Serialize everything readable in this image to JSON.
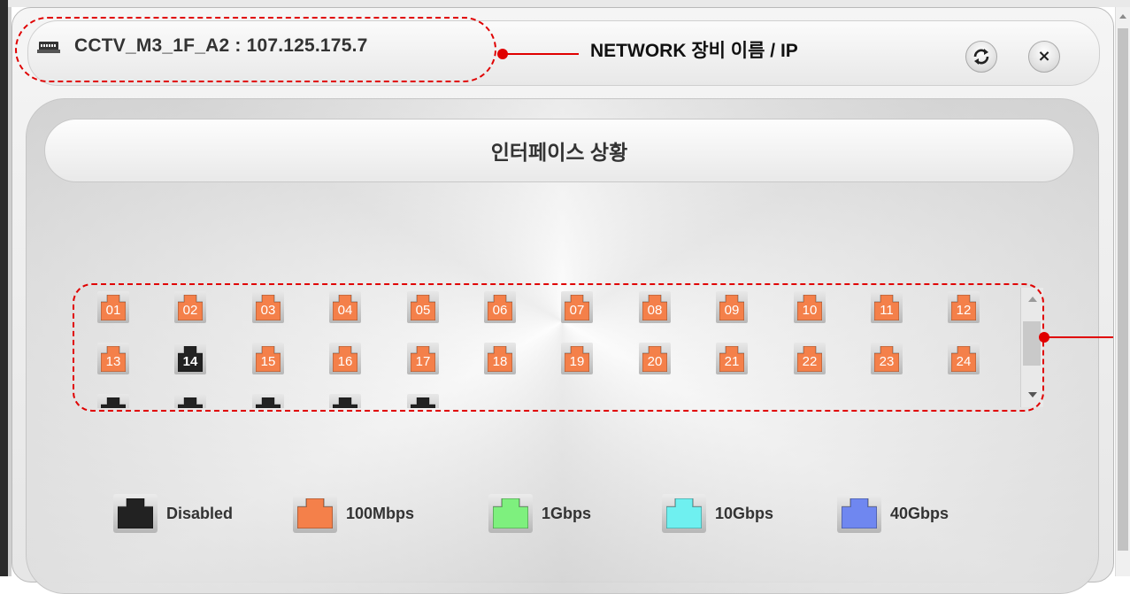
{
  "window": {
    "device_name": "CCTV_M3_1F_A2 : 107.125.175.7",
    "annotation_label": "NETWORK 장비 이름 / IP"
  },
  "section": {
    "title": "인터페이스 상황"
  },
  "colors": {
    "annotation": "#e00000",
    "disabled": "#222222",
    "speed_100mbps": "#f4804a",
    "speed_1gbps": "#7ef07e",
    "speed_10gbps": "#6ff0f0",
    "speed_40gbps": "#6f87f0"
  },
  "ports": [
    {
      "label": "01",
      "status": "100Mbps"
    },
    {
      "label": "02",
      "status": "100Mbps"
    },
    {
      "label": "03",
      "status": "100Mbps"
    },
    {
      "label": "04",
      "status": "100Mbps"
    },
    {
      "label": "05",
      "status": "100Mbps"
    },
    {
      "label": "06",
      "status": "100Mbps"
    },
    {
      "label": "07",
      "status": "100Mbps"
    },
    {
      "label": "08",
      "status": "100Mbps"
    },
    {
      "label": "09",
      "status": "100Mbps"
    },
    {
      "label": "10",
      "status": "100Mbps"
    },
    {
      "label": "11",
      "status": "100Mbps"
    },
    {
      "label": "12",
      "status": "100Mbps"
    },
    {
      "label": "13",
      "status": "100Mbps"
    },
    {
      "label": "14",
      "status": "Disabled"
    },
    {
      "label": "15",
      "status": "100Mbps"
    },
    {
      "label": "16",
      "status": "100Mbps"
    },
    {
      "label": "17",
      "status": "100Mbps"
    },
    {
      "label": "18",
      "status": "100Mbps"
    },
    {
      "label": "19",
      "status": "100Mbps"
    },
    {
      "label": "20",
      "status": "100Mbps"
    },
    {
      "label": "21",
      "status": "100Mbps"
    },
    {
      "label": "22",
      "status": "100Mbps"
    },
    {
      "label": "23",
      "status": "100Mbps"
    },
    {
      "label": "24",
      "status": "100Mbps"
    },
    {
      "label": "",
      "status": "Disabled"
    },
    {
      "label": "",
      "status": "Disabled"
    },
    {
      "label": "",
      "status": "Disabled"
    },
    {
      "label": "",
      "status": "Disabled"
    },
    {
      "label": "",
      "status": "Disabled"
    }
  ],
  "legend": [
    {
      "label": "Disabled",
      "status": "Disabled"
    },
    {
      "label": "100Mbps",
      "status": "100Mbps"
    },
    {
      "label": "1Gbps",
      "status": "1Gbps"
    },
    {
      "label": "10Gbps",
      "status": "10Gbps"
    },
    {
      "label": "40Gbps",
      "status": "40Gbps"
    }
  ],
  "icons": {
    "device": "network-switch-icon",
    "refresh": "refresh-icon",
    "close": "close-icon",
    "close_glyph": "×"
  }
}
